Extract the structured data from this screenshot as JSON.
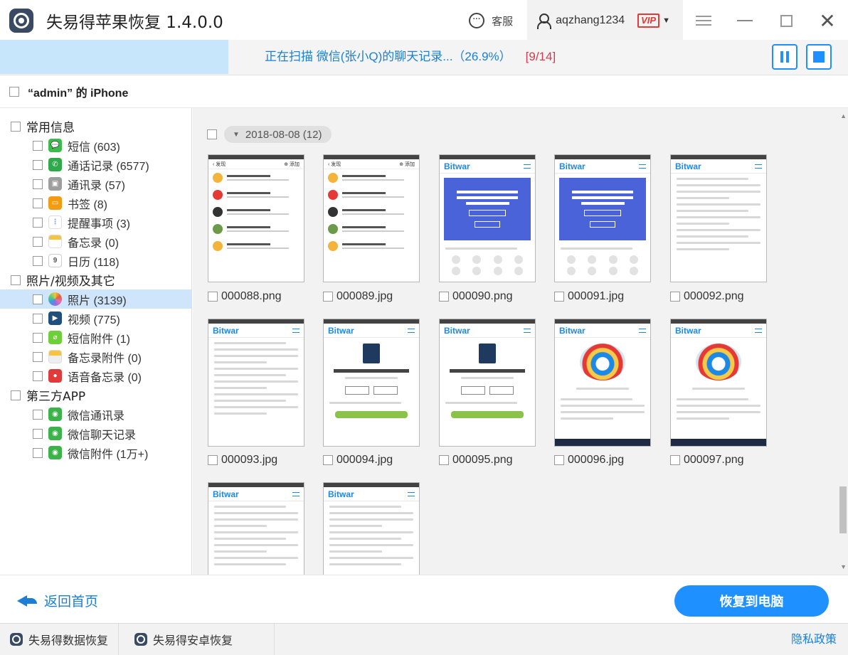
{
  "app": {
    "title": "失易得苹果恢复 1.4.0.0",
    "support_label": "客服",
    "support_icon": "chat-bubble-icon",
    "username": "aqzhang1234",
    "vip_badge": "VIP",
    "accent_color": "#1e90ff"
  },
  "scan": {
    "status_text": "正在扫描 微信(张小Q)的聊天记录...（26.9%）",
    "progress_percent": 26.9,
    "counter": "[9/14]",
    "pause_icon": "pause-icon",
    "stop_icon": "stop-icon"
  },
  "device": {
    "label": "“admin” 的 iPhone"
  },
  "sidebar": {
    "groups": [
      {
        "label": "常用信息",
        "items": [
          {
            "label": "短信 (603)",
            "icon": "sms-icon",
            "color": "#3dbb4a"
          },
          {
            "label": "通话记录 (6577)",
            "icon": "phone-icon",
            "color": "#2eaa4a"
          },
          {
            "label": "通讯录 (57)",
            "icon": "contacts-icon",
            "color": "#9e9e9e"
          },
          {
            "label": "书签 (8)",
            "icon": "bookmark-icon",
            "color": "#f39c12"
          },
          {
            "label": "提醒事项 (3)",
            "icon": "reminder-icon",
            "color": "#7aa6d6"
          },
          {
            "label": "备忘录 (0)",
            "icon": "notes-icon",
            "color": "#f5c542"
          },
          {
            "label": "日历 (118)",
            "icon": "calendar-icon",
            "color": "#ffffff"
          }
        ]
      },
      {
        "label": "照片/视频及其它",
        "items": [
          {
            "label": "照片 (3139)",
            "icon": "photos-icon",
            "color": "#e26fb3",
            "selected": true
          },
          {
            "label": "视频 (775)",
            "icon": "video-icon",
            "color": "#1f4f7a"
          },
          {
            "label": "短信附件 (1)",
            "icon": "attachment-icon",
            "color": "#6fcf3b"
          },
          {
            "label": "备忘录附件 (0)",
            "icon": "notes-attachment-icon",
            "color": "#f5c542"
          },
          {
            "label": "语音备忘录 (0)",
            "icon": "voice-memo-icon",
            "color": "#e03a3a"
          }
        ]
      },
      {
        "label": "第三方APP",
        "items": [
          {
            "label": "微信通讯录",
            "icon": "wechat-icon",
            "color": "#3cb34a"
          },
          {
            "label": "微信聊天记录",
            "icon": "wechat-icon",
            "color": "#3cb34a"
          },
          {
            "label": "微信附件 (1万+)",
            "icon": "wechat-icon",
            "color": "#3cb34a"
          }
        ]
      }
    ]
  },
  "gallery": {
    "date_label": "2018-08-08 (12)",
    "files": [
      "000088.png",
      "000089.jpg",
      "000090.png",
      "000091.jpg",
      "000092.png",
      "000093.jpg",
      "000094.jpg",
      "000095.png",
      "000096.jpg",
      "000097.png",
      "",
      ""
    ]
  },
  "bottom": {
    "back_label": "返回首页",
    "back_icon": "back-arrow-icon",
    "recover_label": "恢复到电脑"
  },
  "footer": {
    "tabs": [
      "失易得数据恢复",
      "失易得安卓恢复"
    ],
    "privacy": "隐私政策"
  }
}
